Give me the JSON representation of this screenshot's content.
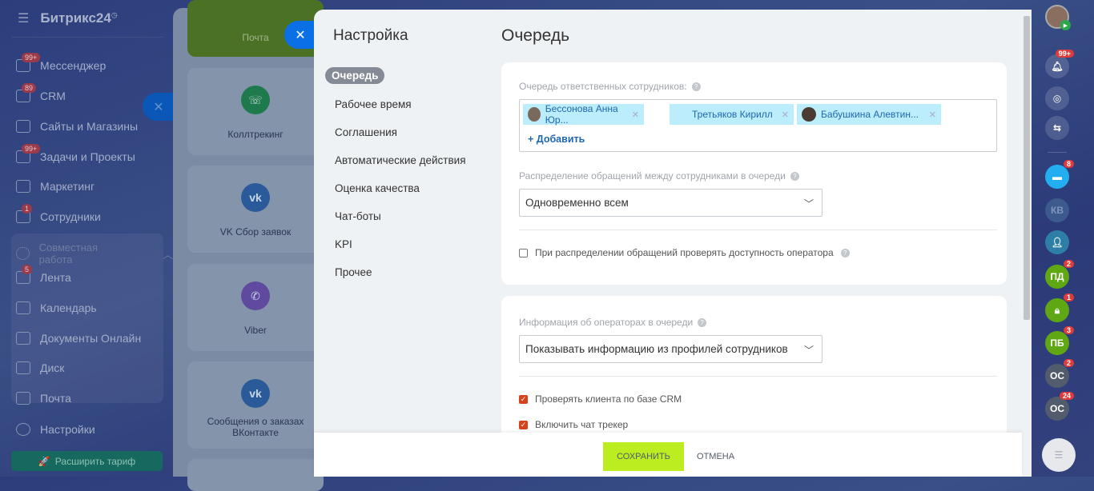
{
  "sidebar": {
    "logo": "Битрикс24",
    "items": [
      {
        "label": "Мессенджер",
        "badge": "99+"
      },
      {
        "label": "CRM",
        "badge": "89"
      },
      {
        "label": "Сайты и Магазины"
      },
      {
        "label": "Задачи и Проекты",
        "badge": "99+"
      },
      {
        "label": "Маркетинг"
      },
      {
        "label": "Сотрудники",
        "badge": "1"
      },
      {
        "label": "Совместная работа"
      },
      {
        "label": "Лента",
        "badge": "5"
      },
      {
        "label": "Календарь"
      },
      {
        "label": "Документы Онлайн"
      },
      {
        "label": "Диск"
      },
      {
        "label": "Почта"
      },
      {
        "label": "Настройки"
      }
    ],
    "upgrade": "Расширить тариф"
  },
  "tiles": [
    "Почта",
    "Коллтрекинг",
    "VK Сбор заявок",
    "Viber",
    "Сообщения о заказах ВКонтакте"
  ],
  "settings": {
    "title": "Настройка",
    "menu": [
      "Очередь",
      "Рабочее время",
      "Соглашения",
      "Автоматические действия",
      "Оценка качества",
      "Чат-боты",
      "KPI",
      "Прочее"
    ]
  },
  "page": {
    "title": "Очередь",
    "queue_label": "Очередь ответственных сотрудников:",
    "employees": [
      "Бессонова Анна Юр...",
      "Третьяков Кирилл",
      "Бабушкина Алевтин..."
    ],
    "add": "+ Добавить",
    "distribution_label": "Распределение обращений между сотрудниками в очереди",
    "distribution_value": "Одновременно всем",
    "check_availability": {
      "label": "При распределении обращений проверять доступность оператора",
      "checked": false
    },
    "operators_label": "Информация об операторах в очереди",
    "operators_value": "Показывать информацию из профилей сотрудников",
    "check_crm": {
      "label": "Проверять клиента по базе CRM",
      "checked": true
    },
    "chat_tracker": {
      "label": "Включить чат трекер",
      "checked": true
    }
  },
  "footer": {
    "save": "СОХРАНИТЬ",
    "cancel": "ОТМЕНА"
  },
  "rightbar": {
    "notifications": "99+",
    "chat_badge": "8",
    "items": [
      {
        "label": "КВ"
      },
      {
        "label": "ПД",
        "badge": "2"
      },
      {
        "label": "",
        "badge": "1"
      },
      {
        "label": "ПБ",
        "badge": "3"
      },
      {
        "label": "ОС",
        "badge": "2"
      },
      {
        "label": "ОС",
        "badge": "24"
      }
    ]
  }
}
